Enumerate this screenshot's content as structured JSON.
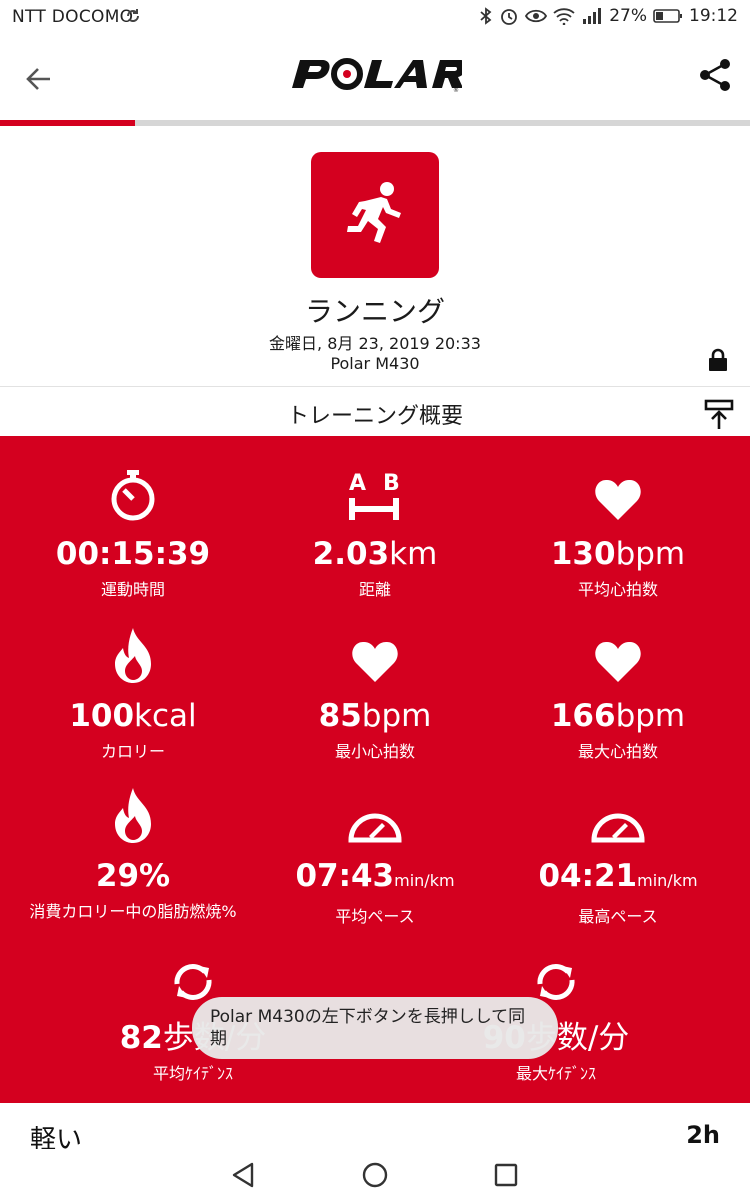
{
  "status_bar": {
    "carrier": "NTT DOCOMO",
    "battery": "27%",
    "time": "19:12"
  },
  "progress": 0.18,
  "colors": {
    "accent": "#d4001f",
    "background": "#ffffff",
    "text": "#111111"
  },
  "session": {
    "sport": "ランニング",
    "datetime": "金曜日, 8月 23, 2019 20:33",
    "device": "Polar M430",
    "sport_icon": "runner-icon"
  },
  "summary": {
    "title": "トレーニング概要"
  },
  "stats": {
    "duration": {
      "value": "00:15:39",
      "label": "運動時間",
      "icon": "stopwatch-icon"
    },
    "distance": {
      "value": "2.03",
      "unit": "km",
      "label": "距離",
      "icon": "distance-ab-icon"
    },
    "avg_hr": {
      "value": "130",
      "unit": "bpm",
      "label": "平均心拍数",
      "icon": "heart-icon"
    },
    "calories": {
      "value": "100",
      "unit": "kcal",
      "label": "カロリー",
      "icon": "flame-icon"
    },
    "min_hr": {
      "value": "85",
      "unit": "bpm",
      "label": "最小心拍数",
      "icon": "heart-icon"
    },
    "max_hr": {
      "value": "166",
      "unit": "bpm",
      "label": "最大心拍数",
      "icon": "heart-icon"
    },
    "fat_burn": {
      "value": "29%",
      "label": "消費カロリー中の脂肪燃焼%",
      "icon": "flame-icon"
    },
    "avg_pace": {
      "value": "07:43",
      "unit": "min/km",
      "label": "平均ペース",
      "icon": "speedometer-icon"
    },
    "max_pace": {
      "value": "04:21",
      "unit": "min/km",
      "label": "最高ペース",
      "icon": "speedometer-icon"
    },
    "avg_cadence": {
      "value": "82",
      "unit": "歩数/分",
      "label": "平均ｹｲﾃﾞﾝｽ",
      "icon": "cadence-icon"
    },
    "max_cadence": {
      "value": "90",
      "unit": "歩数/分",
      "label": "最大ｹｲﾃﾞﾝｽ",
      "icon": "cadence-icon"
    }
  },
  "zone_row": {
    "label": "軽い",
    "value": "2h"
  },
  "toast": {
    "text": "Polar M430の左下ボタンを長押しして同期"
  }
}
